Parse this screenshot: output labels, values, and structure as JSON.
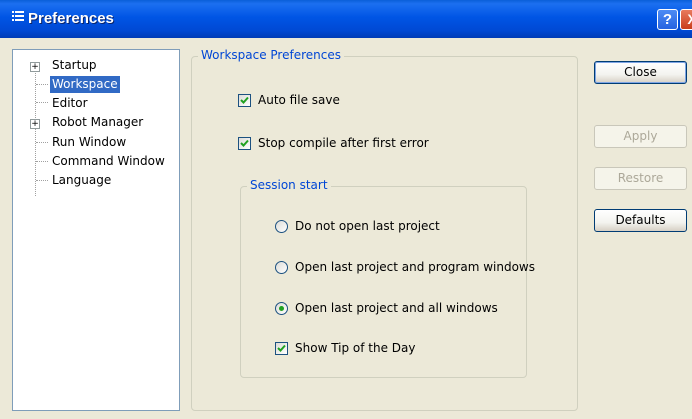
{
  "window": {
    "title": "Preferences",
    "help_label": "?",
    "close_label": "X"
  },
  "tree": {
    "items": [
      {
        "label": "Startup",
        "expandable": true,
        "expand_glyph": "+"
      },
      {
        "label": "Workspace",
        "selected": true
      },
      {
        "label": "Editor"
      },
      {
        "label": "Robot Manager",
        "expandable": true,
        "expand_glyph": "+"
      },
      {
        "label": "Run Window"
      },
      {
        "label": "Command Window"
      },
      {
        "label": "Language"
      }
    ]
  },
  "workspace": {
    "legend": "Workspace Preferences",
    "auto_save": {
      "label": "Auto file save",
      "checked": true
    },
    "stop_compile": {
      "label": "Stop compile after first error",
      "checked": true
    },
    "session": {
      "legend": "Session start",
      "options": [
        {
          "label": "Do not open last project",
          "selected": false
        },
        {
          "label": "Open last project and program windows",
          "selected": false
        },
        {
          "label": "Open last project and all windows",
          "selected": true
        }
      ],
      "show_tip": {
        "label": "Show Tip of the Day",
        "checked": true
      }
    }
  },
  "buttons": {
    "close": "Close",
    "apply": "Apply",
    "restore": "Restore",
    "defaults": "Defaults"
  },
  "colors": {
    "titlebar": "#0055e5",
    "selection": "#316ac5",
    "groupbox_legend": "#0046d5",
    "radio_dot": "#21a121",
    "disabled_text": "#aca899"
  }
}
